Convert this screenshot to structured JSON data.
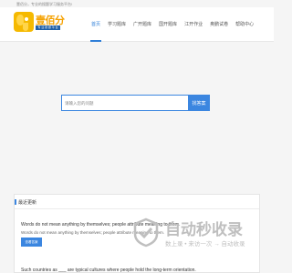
{
  "topbar": {
    "text": "壹佰分，专业的搜题学习服务平台!"
  },
  "header": {
    "logo_title": "壹佰分",
    "logo_subtitle": "专 业 搜 题 平 台"
  },
  "nav": {
    "items": [
      {
        "label": "首页",
        "active": true
      },
      {
        "label": "学习题库",
        "active": false
      },
      {
        "label": "广开题库",
        "active": false
      },
      {
        "label": "国开题库",
        "active": false
      },
      {
        "label": "江开作业",
        "active": false
      },
      {
        "label": "奥鹏试卷",
        "active": false
      },
      {
        "label": "帮助中心",
        "active": false
      }
    ]
  },
  "search": {
    "placeholder": "请输入您的问题",
    "button_label": "找答案"
  },
  "recent": {
    "title": "最近更新",
    "items": [
      {
        "title": "Words do not mean anything by themselves; people attribute meaning to them.",
        "snippet": "Words do not mean anything by themselves; people attribute meaning to them.",
        "button_label": "查看答案"
      },
      {
        "title": "Such countries as ___ are typical cultures where people hold the long-term orientation."
      }
    ]
  },
  "watermark": {
    "title": "自动秒收录",
    "subtitle": "数上录 • 来访一次 → 自动收录"
  },
  "colors": {
    "accent": "#3b86e0",
    "logo": "#f5a100"
  }
}
